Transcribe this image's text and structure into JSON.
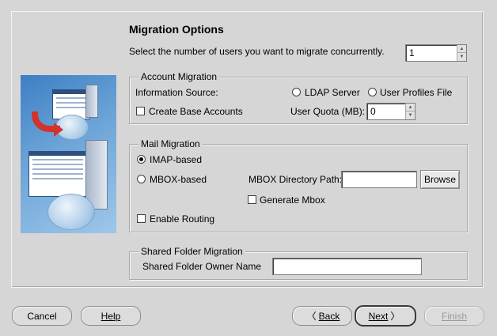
{
  "header": {
    "title": "Migration Options",
    "concurrency_label": "Select the number of users you want to migrate concurrently.",
    "concurrency_value": "1"
  },
  "account": {
    "legend": "Account Migration",
    "info_source_label": "Information Source:",
    "ldap_label": "LDAP Server",
    "profiles_label": "User Profiles File",
    "create_base_label": "Create Base Accounts",
    "quota_label": "User Quota (MB):",
    "quota_value": "0"
  },
  "mail": {
    "legend": "Mail Migration",
    "imap_label": "IMAP-based",
    "mbox_label": "MBOX-based",
    "mbox_path_label": "MBOX Directory Path:",
    "mbox_path_value": "",
    "browse_label": "Browse",
    "generate_mbox_label": "Generate Mbox",
    "enable_routing_label": "Enable Routing"
  },
  "shared": {
    "legend": "Shared Folder Migration",
    "owner_label": "Shared Folder Owner Name",
    "owner_value": ""
  },
  "footer": {
    "cancel_label": "Cancel",
    "help_label": "Help",
    "back_label": "Back",
    "next_label": "Next",
    "finish_label": "Finish"
  },
  "state": {
    "selected_source": "none",
    "selected_mail_type": "IMAP-based",
    "create_base_accounts": false,
    "generate_mbox": false,
    "enable_routing": false
  },
  "colors": {
    "background": "#d6d6d6",
    "image_blue": "#3d7fc4",
    "arrow_red": "#d3332b"
  }
}
